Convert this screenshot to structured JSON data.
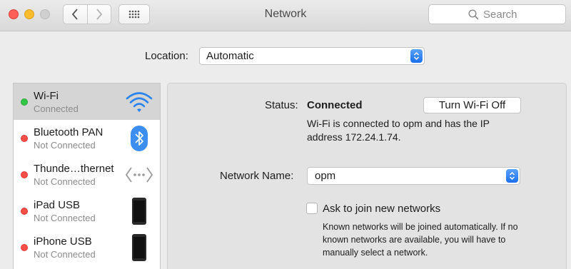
{
  "window": {
    "title": "Network"
  },
  "search": {
    "placeholder": "Search"
  },
  "location": {
    "label": "Location:",
    "value": "Automatic"
  },
  "services": [
    {
      "name": "Wi-Fi",
      "status": "Connected",
      "state": "green",
      "icon": "wifi-icon"
    },
    {
      "name": "Bluetooth PAN",
      "status": "Not Connected",
      "state": "red",
      "icon": "bluetooth-icon"
    },
    {
      "name": "Thunde…thernet",
      "status": "Not Connected",
      "state": "red",
      "icon": "ethernet-icon"
    },
    {
      "name": "iPad USB",
      "status": "Not Connected",
      "state": "red",
      "icon": "ipad-icon"
    },
    {
      "name": "iPhone USB",
      "status": "Not Connected",
      "state": "red",
      "icon": "iphone-icon"
    }
  ],
  "detail": {
    "status_label": "Status:",
    "status_value": "Connected",
    "toggle_button": "Turn Wi-Fi Off",
    "status_description": "Wi-Fi is connected to opm and has the IP address 172.24.1.74.",
    "network_name_label": "Network Name:",
    "network_name_value": "opm",
    "ask_to_join_label": "Ask to join new networks",
    "ask_to_join_checked": false,
    "help_text": "Known networks will be joined automatically. If no known networks are available, you will have to manually select a network."
  },
  "colors": {
    "accent": "#1a6fef",
    "connected": "#32c647",
    "not_connected": "#fc4f48"
  }
}
